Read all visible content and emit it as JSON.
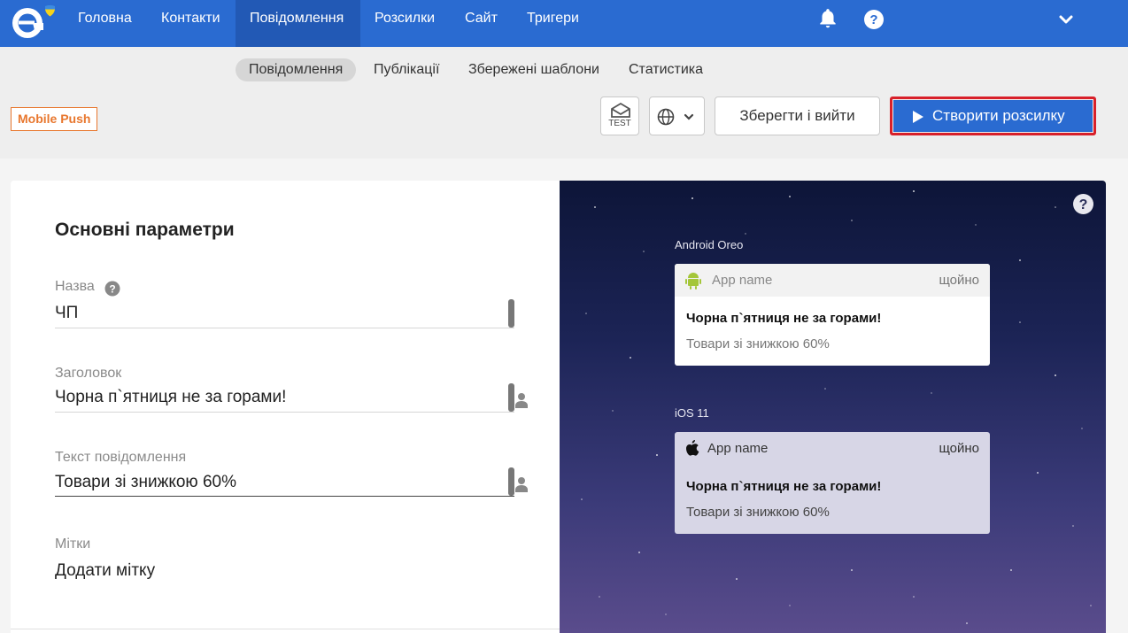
{
  "topnav": {
    "items": [
      {
        "label": "Головна"
      },
      {
        "label": "Контакти"
      },
      {
        "label": "Повідомлення"
      },
      {
        "label": "Розсилки"
      },
      {
        "label": "Сайт"
      },
      {
        "label": "Тригери"
      }
    ],
    "active": "Повідомлення"
  },
  "subnav": {
    "items": [
      {
        "label": "Повідомлення"
      },
      {
        "label": "Публікації"
      },
      {
        "label": "Збережені шаблони"
      },
      {
        "label": "Статистика"
      }
    ]
  },
  "toolbar": {
    "badge": "Mobile Push",
    "test_label": "TEST",
    "save_label": "Зберегти і вийти",
    "create_label": "Створити розсилку"
  },
  "form": {
    "section_title": "Основні параметри",
    "name_label": "Назва",
    "name_value": "ЧП",
    "title_label": "Заголовок",
    "title_value": "Чорна п`ятниця не за горами!",
    "text_label": "Текст повідомлення",
    "text_value": "Товари зі знижкою 60%",
    "tags_label": "Мітки",
    "tags_value": "Додати мітку"
  },
  "preview": {
    "android": {
      "platform": "Android Oreo",
      "app_name": "App name",
      "time": "щойно",
      "title": "Чорна п`ятниця не за горами!",
      "text": "Товари зі знижкою 60%"
    },
    "ios": {
      "platform": "iOS 11",
      "app_name": "App name",
      "time": "щойно",
      "title": "Чорна п`ятниця не за горами!",
      "text": "Товари зі знижкою 60%"
    }
  },
  "colors": {
    "brand": "#2a6bd1",
    "badge": "#e8772e",
    "highlight": "#d8202a"
  }
}
